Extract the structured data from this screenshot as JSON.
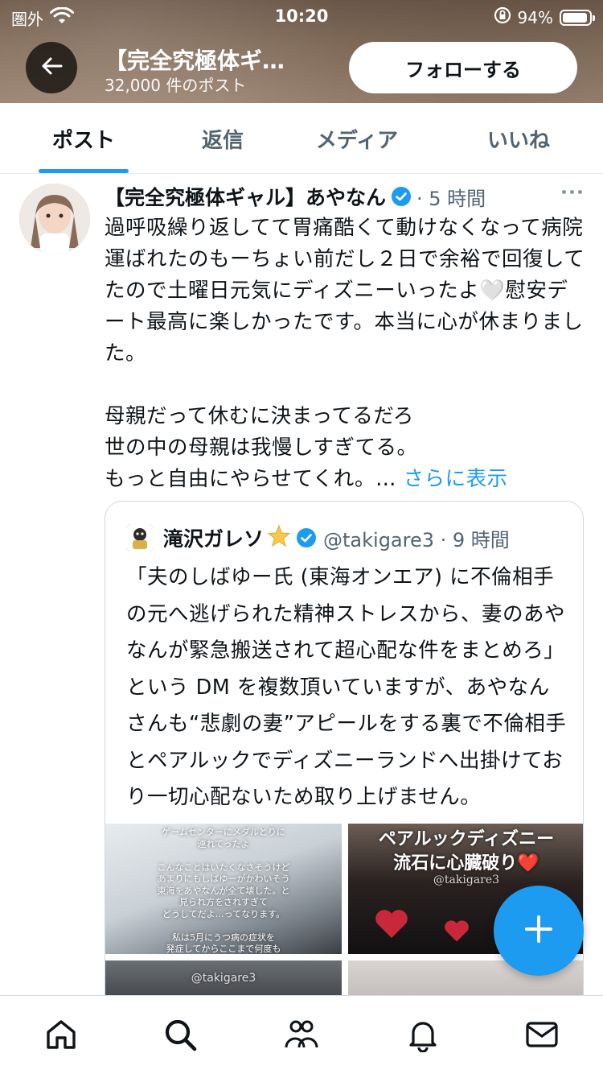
{
  "status_bar": {
    "carrier": "圏外",
    "time": "10:20",
    "battery_pct": "94%",
    "battery_level": 0.94
  },
  "header": {
    "title": "【完全究極体ギ…",
    "subtitle": "32,000 件のポスト",
    "follow_label": "フォローする"
  },
  "tabs": [
    {
      "label": "ポスト",
      "active": true
    },
    {
      "label": "返信"
    },
    {
      "label": "メディア"
    },
    {
      "label": "いいね"
    }
  ],
  "tweet": {
    "display_name": "【完全究極体ギャル】あやなん",
    "time": "· 5 時間",
    "body": "過呼吸繰り返してて胃痛酷くて動けなくなって病院運ばれたのもーちょい前だし２日で余裕で回復してたので土曜日元気にディズニーいったよ🤍慰安デート最高に楽しかったです。本当に心が休まりました。\n\n母親だって休むに決まってるだろ\n世の中の母親は我慢しすぎてる。\nもっと自由にやらせてくれ。… ",
    "show_more": "さらに表示"
  },
  "quote": {
    "display_name": "滝沢ガレソ",
    "star": "🌟",
    "handle_time": "@takigare3 · 9 時間",
    "body": "「夫のしばゆー氏 (東海オンエア) に不倫相手の元へ逃げられた精神ストレスから、妻のあやなんが緊急搬送されて超心配な件をまとめろ」という DM を複数頂いていますが、あやなんさんも“悲劇の妻”アピールをする裏で不倫相手とペアルックでディズニーランドへ出掛けており一切心配ないため取り上げません。",
    "media": [
      {
        "caption": "ゲームセンターにメダルとりに\n連れてったよ\n\nこんなことはいたくなさそうけど\nあまりにもしばゆーがかわいそう\n東海をあやなんが全て壊した。と\n見られ方をされすぎて\nどうしてだよ…ってなります。\n\n私は5月にうつ病の症状を\n発症してからここまで何度も"
      },
      {
        "caption": "ペアルックディズニー\n流石に心臓破り❤️",
        "watermark": "@takigare3"
      },
      {
        "watermark": "@takigare3"
      },
      {}
    ]
  },
  "icons": {
    "accent": "#1d9bf0",
    "text": "#0f1419",
    "muted": "#536471"
  },
  "nav": [
    "home-icon",
    "search-icon",
    "communities-icon",
    "notifications-icon",
    "messages-icon"
  ]
}
